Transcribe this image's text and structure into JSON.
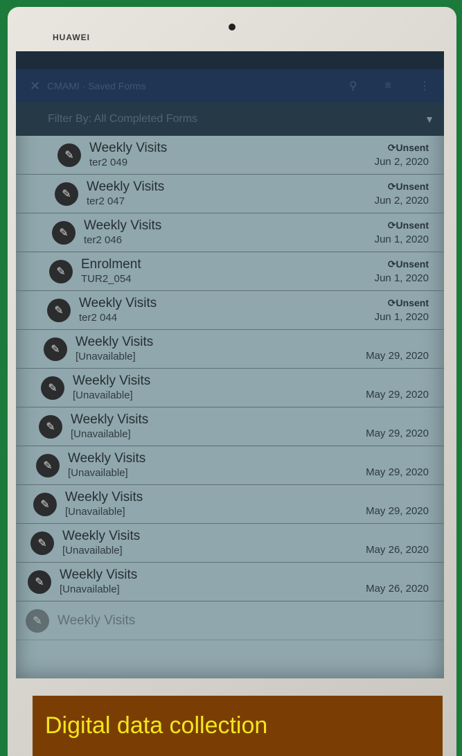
{
  "device": {
    "brand": "HUAWEI"
  },
  "appbar": {
    "title": "CMAMI · Saved Forms"
  },
  "filter": {
    "label": "Filter By: All Completed Forms"
  },
  "rows": [
    {
      "name": "Weekly Visits",
      "sub": "ter2 049",
      "status": "Unsent",
      "date": "Jun 2, 2020"
    },
    {
      "name": "Weekly Visits",
      "sub": "ter2 047",
      "status": "Unsent",
      "date": "Jun 2, 2020"
    },
    {
      "name": "Weekly Visits",
      "sub": "ter2 046",
      "status": "Unsent",
      "date": "Jun 1, 2020"
    },
    {
      "name": "Enrolment",
      "sub": "TUR2_054",
      "status": "Unsent",
      "date": "Jun 1, 2020"
    },
    {
      "name": "Weekly Visits",
      "sub": "ter2 044",
      "status": "Unsent",
      "date": "Jun 1, 2020"
    },
    {
      "name": "Weekly Visits",
      "sub": "[Unavailable]",
      "status": "",
      "date": "May 29, 2020"
    },
    {
      "name": "Weekly Visits",
      "sub": "[Unavailable]",
      "status": "",
      "date": "May 29, 2020"
    },
    {
      "name": "Weekly Visits",
      "sub": "[Unavailable]",
      "status": "",
      "date": "May 29, 2020"
    },
    {
      "name": "Weekly Visits",
      "sub": "[Unavailable]",
      "status": "",
      "date": "May 29, 2020"
    },
    {
      "name": "Weekly Visits",
      "sub": "[Unavailable]",
      "status": "",
      "date": "May 29, 2020"
    },
    {
      "name": "Weekly Visits",
      "sub": "[Unavailable]",
      "status": "",
      "date": "May 26, 2020"
    },
    {
      "name": "Weekly Visits",
      "sub": "[Unavailable]",
      "status": "",
      "date": "May 26, 2020"
    },
    {
      "name": "Weekly Visits",
      "sub": "",
      "status": "",
      "date": ""
    }
  ],
  "caption": {
    "text": "Digital data collection"
  },
  "icons": {
    "row": "pencil-icon",
    "sync": "sync-icon",
    "filter": "filter-icon",
    "menu": "menu-icon",
    "search": "search-icon",
    "more": "more-icon"
  },
  "colors": {
    "background": "#1c7a3a",
    "caption_bg": "#7a3e05",
    "caption_text": "#f4e61a",
    "appbar": "#203553"
  }
}
